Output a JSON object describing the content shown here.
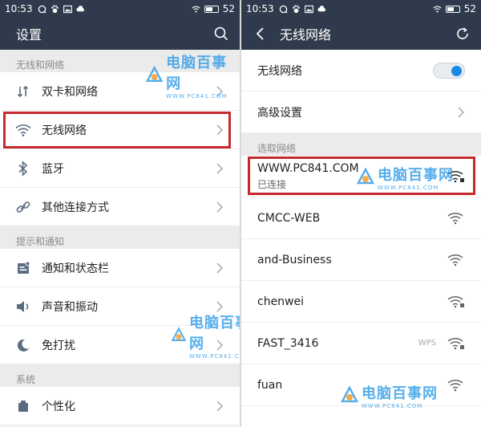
{
  "left": {
    "status": {
      "time": "10:53",
      "battery": "52"
    },
    "header": {
      "title": "设置"
    },
    "sections": [
      {
        "title": "无线和网络",
        "items": [
          {
            "label": "双卡和网络",
            "icon": "sim-icon"
          },
          {
            "label": "无线网络",
            "icon": "wifi-icon",
            "highlighted": true
          },
          {
            "label": "蓝牙",
            "icon": "bluetooth-icon"
          },
          {
            "label": "其他连接方式",
            "icon": "link-icon"
          }
        ]
      },
      {
        "title": "提示和通知",
        "items": [
          {
            "label": "通知和状态栏",
            "icon": "notification-icon"
          },
          {
            "label": "声音和振动",
            "icon": "sound-icon"
          },
          {
            "label": "免打扰",
            "icon": "moon-icon"
          }
        ]
      },
      {
        "title": "系统",
        "items": [
          {
            "label": "个性化",
            "icon": "personalize-icon"
          }
        ]
      }
    ],
    "watermark": {
      "text": "电脑百事网",
      "url": "WWW.PC841.COM"
    }
  },
  "right": {
    "status": {
      "time": "10:53",
      "battery": "52"
    },
    "header": {
      "title": "无线网络"
    },
    "wifi_toggle_label": "无线网络",
    "wifi_enabled": true,
    "advanced_label": "高级设置",
    "section_title": "选取网络",
    "networks": [
      {
        "name": "WWW.PC841.COM",
        "status": "已连接",
        "locked": true,
        "highlighted": true
      },
      {
        "name": "CMCC-WEB",
        "locked": false
      },
      {
        "name": "and-Business",
        "locked": false
      },
      {
        "name": "chenwei",
        "locked": true
      },
      {
        "name": "FAST_3416",
        "locked": true,
        "wps": "WPS"
      },
      {
        "name": "fuan",
        "locked": false
      }
    ],
    "watermark": {
      "text": "电脑百事网",
      "url": "WWW.PC841.COM"
    }
  },
  "colors": {
    "appbar": "#2f3b4c",
    "accent": "#1e88e5",
    "highlight": "#c62a2f"
  }
}
